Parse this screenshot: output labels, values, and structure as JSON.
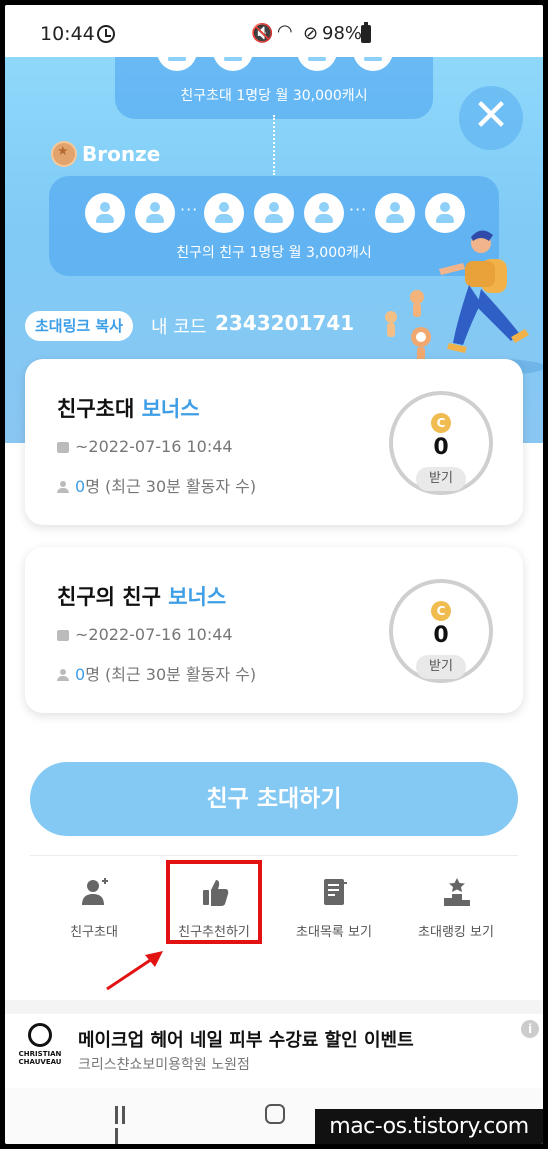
{
  "status_bar": {
    "time": "10:44",
    "battery": "98%",
    "icons": [
      "clock-icon",
      "mute-icon",
      "wifi-icon",
      "blocked-icon",
      "battery-icon"
    ]
  },
  "hero": {
    "top_tier_caption": "친구초대 1명당 월 30,000캐시",
    "bronze_label": "Bronze",
    "bronze_caption": "친구의 친구 1명당 월 3,000캐시",
    "ellipsis": "···",
    "copy_link_label": "초대링크 복사",
    "my_code_label": "내 코드",
    "my_code": "2343201741",
    "close_glyph": "✕"
  },
  "cards": [
    {
      "title": "친구초대",
      "title_accent": "보너스",
      "date": "~2022-07-16 10:44",
      "count_num": "0",
      "count_text": "명 (최근 30분 활동자 수)",
      "coin": "C",
      "value": "0",
      "claim_label": "받기"
    },
    {
      "title": "친구의 친구",
      "title_accent": "보너스",
      "date": "~2022-07-16 10:44",
      "count_num": "0",
      "count_text": "명 (최근 30분 활동자 수)",
      "coin": "C",
      "value": "0",
      "claim_label": "받기"
    }
  ],
  "invite_button": "친구 초대하기",
  "menu": [
    {
      "label": "친구초대",
      "icon": "add-friend-icon"
    },
    {
      "label": "친구추천하기",
      "icon": "thumbs-up-icon"
    },
    {
      "label": "초대목록 보기",
      "icon": "list-icon"
    },
    {
      "label": "초대랭킹 보기",
      "icon": "ranking-icon"
    }
  ],
  "ad": {
    "logo_text": "CHRISTIAN CHAUVEAU",
    "title": "메이크업 헤어 네일 피부 수강료 할인 이벤트",
    "subtitle": "크리스챤쇼보미용학원 노원점",
    "info_glyph": "i"
  },
  "watermark": "mac-os.tistory.com",
  "colors": {
    "accent": "#3f9ee6",
    "hero_blue": "#8fd8fb",
    "invite_button": "#84c8f4",
    "highlight_red": "#e21212"
  }
}
